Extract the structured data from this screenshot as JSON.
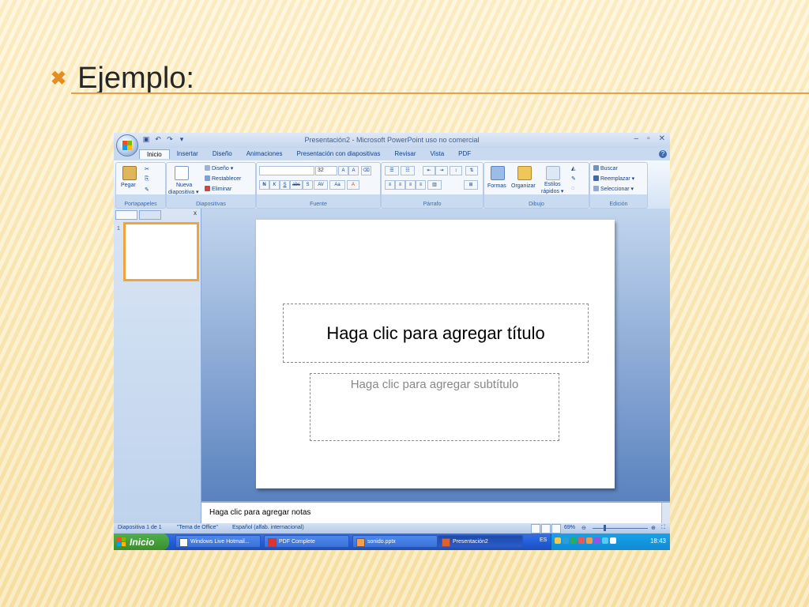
{
  "slide": {
    "bullet": "✖",
    "title": "Ejemplo:"
  },
  "window": {
    "title": "Presentación2 - Microsoft PowerPoint uso no comercial",
    "qat": [
      "save-icon",
      "undo-icon",
      "redo-icon",
      "customize-icon"
    ],
    "controls": {
      "minimize": "–",
      "restore": "▫",
      "close": "✕"
    }
  },
  "ribbon": {
    "tabs": [
      "Inicio",
      "Insertar",
      "Diseño",
      "Animaciones",
      "Presentación con diapositivas",
      "Revisar",
      "Vista",
      "PDF"
    ],
    "active_tab": "Inicio",
    "groups": {
      "portapapeles": {
        "label": "Portapapeles",
        "paste": "Pegar"
      },
      "diapositivas": {
        "label": "Diapositivas",
        "new_slide_1": "Nueva",
        "new_slide_2": "diapositiva ▾",
        "layout": "Diseño ▾",
        "reset": "Restablecer",
        "delete": "Eliminar"
      },
      "fuente": {
        "label": "Fuente",
        "font_name": "",
        "font_size": "32",
        "bold": "N",
        "italic": "K",
        "underline": "S",
        "strike": "abc",
        "shadow": "S",
        "spacing": "AV",
        "case": "Aa",
        "grow": "A",
        "shrink": "A"
      },
      "parrafo": {
        "label": "Párrafo"
      },
      "dibujo": {
        "label": "Dibujo",
        "shapes": "Formas",
        "arrange": "Organizar",
        "styles_1": "Estilos",
        "styles_2": "rápidos ▾"
      },
      "edicion": {
        "label": "Edición",
        "find": "Buscar",
        "replace": "Reemplazar ▾",
        "select": "Seleccionar ▾"
      }
    }
  },
  "slides_panel": {
    "close": "x",
    "thumbnail_number": "1"
  },
  "editor": {
    "title_placeholder": "Haga clic para agregar título",
    "subtitle_placeholder": "Haga clic para agregar subtítulo",
    "notes_placeholder": "Haga clic para agregar notas"
  },
  "status": {
    "slide_info": "Diapositiva 1 de 1",
    "theme": "\"Tema de Office\"",
    "language": "Español (alfab. internacional)",
    "zoom": "69%"
  },
  "taskbar": {
    "start": "Inicio",
    "items": [
      "Windows Live Hotmail...",
      "PDF Complete",
      "sonido.pptx",
      "Presentación2"
    ],
    "active_item": "Presentación2",
    "lang": "ES",
    "clock": "18:43"
  },
  "colors": {
    "accent": "#e38e1f",
    "ribbon_blue": "#15428b",
    "taskbar_blue": "#245edb"
  }
}
